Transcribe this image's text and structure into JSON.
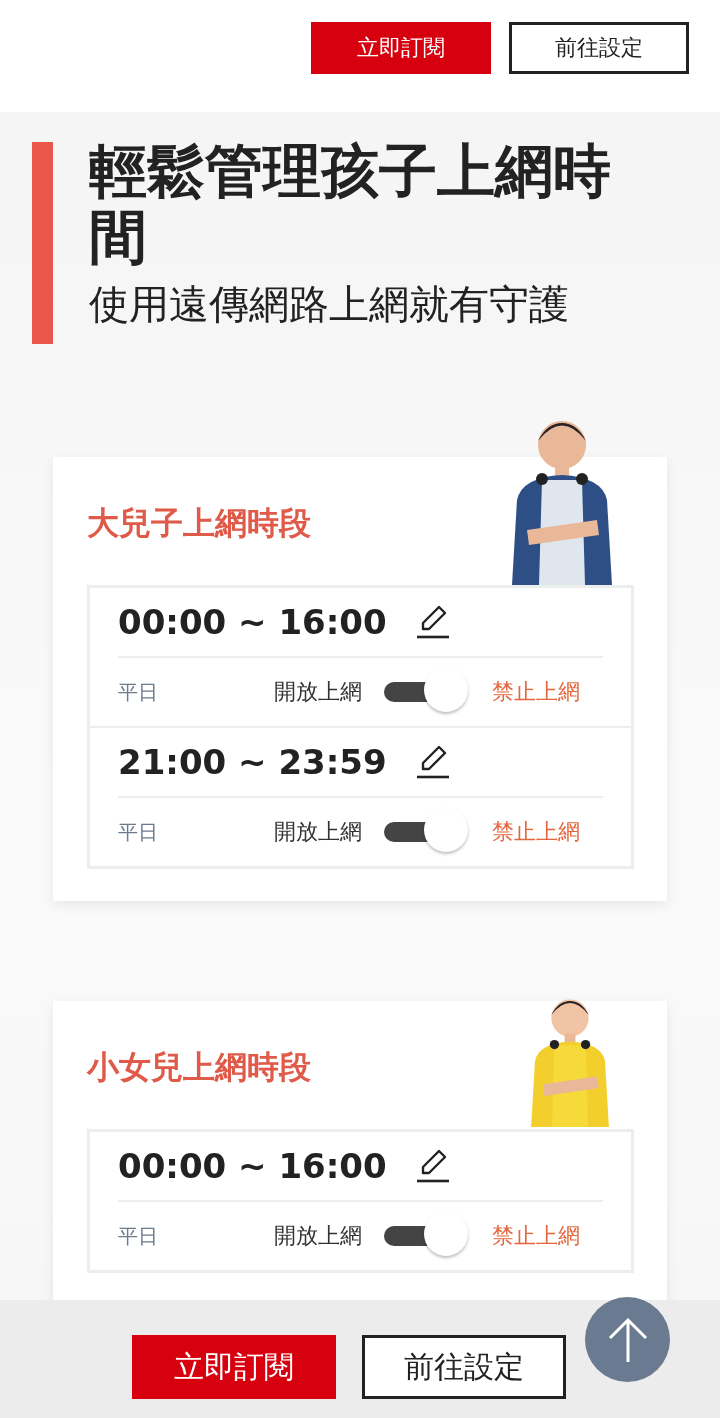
{
  "header": {
    "buttons": [
      {
        "label": "立即訂閱",
        "kind": "primary"
      },
      {
        "label": "前往設定",
        "kind": "outline"
      }
    ]
  },
  "hero": {
    "title": "輕鬆管理孩子上網時間",
    "subtitle": "使用遠傳網路上網就有守護"
  },
  "cards": [
    {
      "title": "大兒子上網時段",
      "kind": "picture",
      "slots": [
        {
          "time": "00:00 ~ 16:00",
          "days": "平日",
          "allow_label": "開放上網",
          "on": true,
          "block_label": "禁止上網"
        },
        {
          "time": "21:00 ~ 23:59",
          "days": "平日",
          "allow_label": "開放上網",
          "on": true,
          "block_label": "禁止上網"
        }
      ]
    },
    {
      "title": "小女兒上網時段",
      "kind": "picture",
      "slots": [
        {
          "time": "00:00 ~ 16:00",
          "days": "平日",
          "allow_label": "開放上網",
          "on": true,
          "block_label": "禁止上網"
        }
      ]
    }
  ],
  "bottom_bar": {
    "buttons": [
      {
        "label": "立即訂閱",
        "kind": "primary"
      },
      {
        "label": "前往設定",
        "kind": "outline"
      }
    ]
  }
}
